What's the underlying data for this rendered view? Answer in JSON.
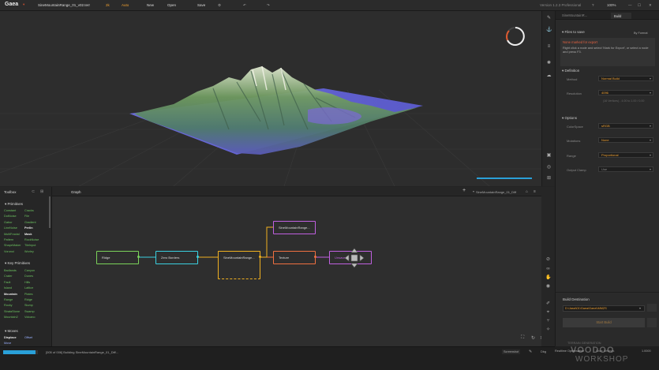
{
  "app": {
    "name": "Gaea",
    "file_name": "SineMountainRange_01_v02.terr",
    "resolution": "2k",
    "build_mode": "Auto",
    "new_label": "New",
    "open_label": "Open",
    "save_label": "Save",
    "version": "Version 1.2.3 Professional",
    "zoom": "100%"
  },
  "toolbox": {
    "title": "Toolbox",
    "primitives_header": "Primitives",
    "primitives_left": [
      "Constant",
      "DotNoise",
      "Gabor",
      "LineNoise",
      "MultiFractal",
      "Pattern",
      "ShapeMaker",
      "Voronoi"
    ],
    "primitives_right": [
      "Cracks",
      "File",
      "Gradient",
      "Perlin",
      "Mask",
      "RockNoise",
      "TileInput",
      "Worley"
    ],
    "key_header": "Key Primitives",
    "key_left": [
      "Badlands",
      "Crater",
      "Fault",
      "Island",
      "Mountain",
      "Range",
      "Rocky",
      "StrataStone",
      "Mountain2"
    ],
    "key_right": [
      "Canyon",
      "Dunes",
      "Hills",
      "Lattice",
      "Plates",
      "Ridge",
      "Slump",
      "Swamp",
      "Volcano"
    ],
    "moves_header": "Moves",
    "moves_left": [
      "Displace",
      "Move"
    ],
    "moves_right": [
      "Offset"
    ]
  },
  "graph": {
    "tab_label": "Graph",
    "document_label": "SineMountainRange_01_Diff",
    "nodes": {
      "ridge": "Ridge",
      "zero_borders": "Zero Borders",
      "sine_main": "SineMountainRange...",
      "texture": "Texture",
      "sine_out": "SineMountainRange...",
      "export": "Unsaved..."
    }
  },
  "right_panel": {
    "tab_node": "SineMountainR...",
    "tab_build": "Build",
    "files_to_save": "Files to save",
    "by_format": "By Format",
    "none_marked": "None marked for export",
    "hint": "Right click a node and select 'Mark for Export', or select a node and press F3.",
    "definition_header": "Definition",
    "method_label": "Method",
    "method_value": "Normal Build",
    "resolution_label": "Resolution",
    "resolution_value": "4096",
    "resolution_note": "(16 Vertices) - 4.00 to 1.00 / 0.00",
    "options_header": "Options",
    "colorspace_label": "ColorSpace",
    "colorspace_value": "sRGB",
    "mutations_label": "Mutations",
    "mutations_value": "None",
    "range_label": "Range",
    "range_value": "Proportional",
    "output_label": "Output Clamp",
    "output_value": "Use",
    "build_dest_label": "Build Destination",
    "build_dest_value": "D:\\Jassi\\01\\Gaea\\Gaea\\\\MMZS",
    "start_build": "Start Build"
  },
  "status": {
    "progress_text": "[005 of 006] Building SineMountainRange_01_Diff...",
    "progress": 0.94,
    "screenshot_label": "Screenshot",
    "debug_label": "Dbg",
    "realtime_label": "Realtime Optimisation",
    "note_label": "Save Settings",
    "zoom_readout": "1.0000"
  },
  "watermark": {
    "line1": "TERRAIN GENERATION",
    "line2": "VOODOO",
    "line3": "WORKSHOP"
  },
  "colors": {
    "accent_blue": "#2aa0d8",
    "ridge_border": "#7bd35a",
    "zero_border": "#3ad0e0",
    "sine_border": "#f0b020",
    "texture_border": "#f07040",
    "export_border": "#c060e0",
    "warn": "#e06040"
  }
}
